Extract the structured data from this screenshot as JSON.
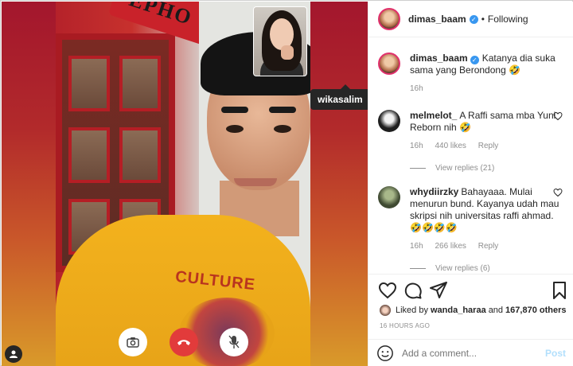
{
  "post": {
    "author": "dimas_baam",
    "follow_label": "Following",
    "dot": "•",
    "caption_user": "dimas_baam",
    "caption_text": "Katanya dia suka sama yang Berondong 🤣",
    "caption_time": "16h"
  },
  "media": {
    "tooltip_user": "wikasalim",
    "sign_text": "EPHO",
    "shirt_text": "CULTURE"
  },
  "comments": [
    {
      "user": "melmelot_",
      "text": "A Raffi sama mba Yuni Reborn nih 🤣",
      "time": "16h",
      "likes": "440 likes",
      "reply": "Reply",
      "view_replies": "View replies (21)"
    },
    {
      "user": "whydiirzky",
      "text": "Bahayaaa. Mulai menurun bund. Kayanya udah mau skripsi nih universitas raffi ahmad. 🤣🤣🤣🤣",
      "time": "16h",
      "likes": "266 likes",
      "reply": "Reply",
      "view_replies": "View replies (6)"
    }
  ],
  "likes": {
    "prefix": "Liked by",
    "user": "wanda_haraa",
    "joiner": "and",
    "others": "167,870 others"
  },
  "timestamp": "16 HOURS AGO",
  "composer": {
    "placeholder": "Add a comment...",
    "post_label": "Post"
  },
  "icons": {
    "like": "heart-icon",
    "comment": "comment-icon",
    "share": "share-icon",
    "save": "bookmark-icon",
    "emoji": "emoji-icon",
    "camera": "camera-icon",
    "end_call": "end-call-icon",
    "mic": "mic-off-icon",
    "user_tag": "user-tag-icon"
  },
  "colors": {
    "verified": "#3897f0",
    "end_call": "#e23b3b",
    "post_disabled": "#b2dffc",
    "story_ring": "#e1306c"
  }
}
